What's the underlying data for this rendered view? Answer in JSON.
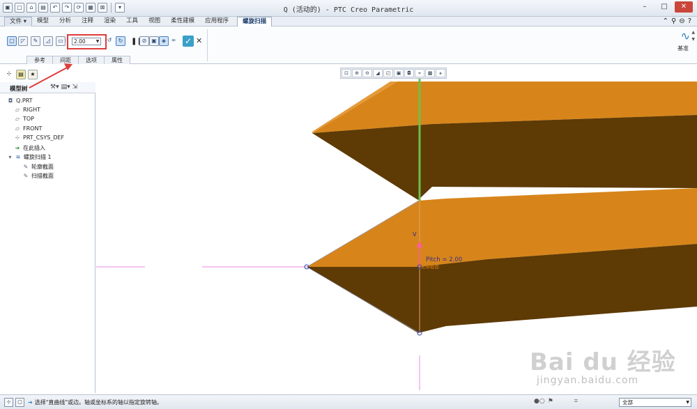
{
  "window": {
    "title": "Q (活动的) - PTC Creo Parametric",
    "controls": [
      "–",
      "□",
      "✕"
    ]
  },
  "menu": {
    "file": "文件",
    "tabs": [
      "模型",
      "分析",
      "注释",
      "渲染",
      "工具",
      "视图",
      "柔性建模",
      "应用程序"
    ],
    "active_tab": "螺旋扫描"
  },
  "ribbon": {
    "pitch_value": "2.00",
    "sub_tabs": [
      "参考",
      "间距",
      "选项",
      "属性"
    ],
    "datum_label": "基准"
  },
  "model_tree": {
    "title": "模型树",
    "items": [
      {
        "icon": "part-icon",
        "label": "Q.PRT"
      },
      {
        "icon": "plane-icon",
        "label": "RIGHT"
      },
      {
        "icon": "plane-icon",
        "label": "TOP"
      },
      {
        "icon": "plane-icon",
        "label": "FRONT"
      },
      {
        "icon": "csys-icon",
        "label": "PRT_CSYS_DEF"
      },
      {
        "icon": "insert-arrow-icon",
        "label": "在此插入"
      },
      {
        "icon": "helical-sweep-icon",
        "label": "螺旋扫描 1"
      },
      {
        "icon": "sketch-icon",
        "label": "轮廓截面"
      },
      {
        "icon": "sketch-icon",
        "label": "扫描截面"
      }
    ]
  },
  "graphics": {
    "pitch_annotation": "Pitch = 2.00",
    "axis_label": "V",
    "profile_label": "轮廓截面"
  },
  "status": {
    "message": "选择\"直曲线\"或边。轴或坐标系的轴以指定旋转轴。",
    "filter": "全部"
  },
  "watermark": {
    "main": "Bai du 经验",
    "sub": "jingyan.baidu.com"
  },
  "colors": {
    "surface_light": "#d7851a",
    "surface_dark": "#5e3a05",
    "axis_green": "#6cc04a",
    "highlight_red": "#e03b3b",
    "accent_blue": "#2a7fc0"
  }
}
